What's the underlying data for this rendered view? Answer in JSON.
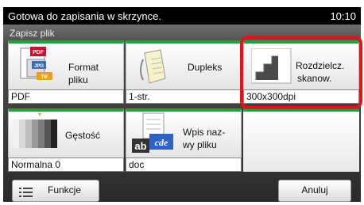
{
  "status_bar": {
    "message": "Gotowa do zapisania w skrzynce.",
    "time": "10:10"
  },
  "panel": {
    "title": "Zapisz plik"
  },
  "tiles": [
    {
      "label_line1": "Format",
      "label_line2": "pliku",
      "value": "PDF",
      "icon": "file-format-icon"
    },
    {
      "label_line1": "Dupleks",
      "label_line2": "",
      "value": "1-str.",
      "icon": "duplex-icon"
    },
    {
      "label_line1": "Rozdzielcz.",
      "label_line2": "skanow.",
      "value": "300x300dpi",
      "icon": "resolution-icon",
      "highlighted": true
    },
    {
      "label_line1": "Gęstość",
      "label_line2": "",
      "value": "Normalna 0",
      "icon": "density-icon"
    },
    {
      "label_line1": "Wpis naz-",
      "label_line2": "wy pliku",
      "value": "doc",
      "icon": "filename-entry-icon"
    }
  ],
  "buttons": {
    "functions": "Funkcje",
    "cancel": "Anuluj"
  },
  "colors": {
    "accent_green": "#25a03a",
    "highlight_red": "#e8101a",
    "panel_gray": "#3c3c3c"
  },
  "pdf_badge": "PDF",
  "jpg_badge": "JPG",
  "tif_badge": "TIF",
  "abcde_text_1": "ab",
  "abcde_text_2": "cde"
}
